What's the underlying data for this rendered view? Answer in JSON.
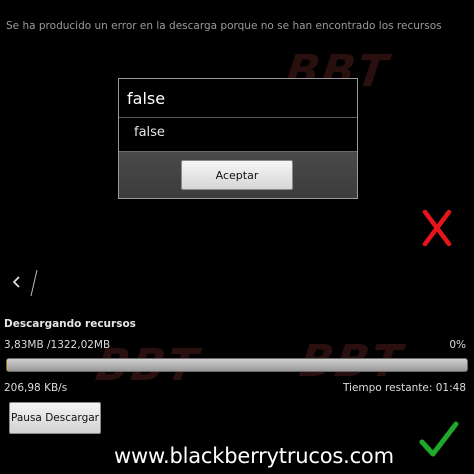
{
  "download": {
    "error_message": "Se ha producido un error en la descarga porque no se han encontrado los recursos",
    "section_title": "Descargando recursos",
    "size_progress": "3,83MB /1322,02MB",
    "percent_text": "0%",
    "progress_fraction": 0.003,
    "speed": "206,98 KB/s",
    "time_remaining": "Tiempo restante: 01:48",
    "pause_label": "Pausa Descargar"
  },
  "dialog": {
    "title": "false",
    "message": "false",
    "accept_label": "Aceptar"
  },
  "footer": {
    "site": "www.blackberrytrucos.com"
  },
  "watermark": {
    "text": "BBT"
  },
  "icons": {
    "back": "chevron-left-icon",
    "fail": "red-x-icon",
    "success": "green-check-icon"
  },
  "colors": {
    "background": "#000000",
    "progress_fill": "#e89c1a",
    "red_x": "#e8141c",
    "green_check": "#1fa82a"
  }
}
